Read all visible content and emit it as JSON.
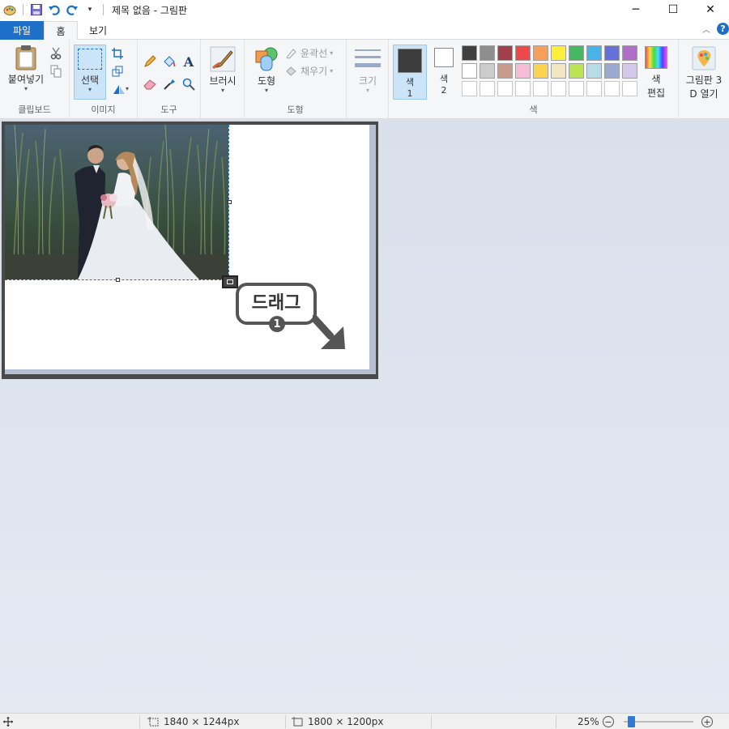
{
  "window": {
    "title": "제목 없음 - 그림판",
    "controls": {
      "minimize": "─",
      "maximize": "☐",
      "close": "✕"
    }
  },
  "tabs": [
    {
      "label": "파일"
    },
    {
      "label": "홈"
    },
    {
      "label": "보기"
    }
  ],
  "ribbon": {
    "clipboard": {
      "paste_label": "붙여넣기",
      "group_label": "클립보드"
    },
    "image": {
      "select_label": "선택",
      "group_label": "이미지"
    },
    "tools": {
      "group_label": "도구"
    },
    "brushes": {
      "label": "브러시"
    },
    "shapes": {
      "shapes_label": "도형",
      "outline_label": "윤곽선",
      "fill_label": "채우기",
      "group_label": "도형"
    },
    "size": {
      "label": "크기"
    },
    "colors": {
      "color1_label": "색",
      "color1_num": "1",
      "color2_label": "색",
      "color2_num": "2",
      "edit_line1": "색",
      "edit_line2": "편집",
      "group_label": "색",
      "color1_value": "#3d3d3d",
      "color2_value": "#ffffff",
      "palette_row1": [
        "#404040",
        "#8e8e8e",
        "#a23f4b",
        "#ec4a4a",
        "#f79f5a",
        "#fdee3c",
        "#46b862",
        "#47b3e8",
        "#6471d9",
        "#b06ec9"
      ],
      "palette_row2": [
        "#ffffff",
        "#cccccc",
        "#c99b8a",
        "#f9bcd6",
        "#fbd34e",
        "#f1e7c2",
        "#b9e351",
        "#b6dcec",
        "#99a9cf",
        "#d5c7ec"
      ]
    },
    "paint3d": {
      "line1": "그림판 3",
      "line2": "D 열기"
    }
  },
  "canvas": {
    "annotation_label": "드래그",
    "annotation_step": "1"
  },
  "status": {
    "selection_size": "1840 × 1244px",
    "canvas_size": "1800 × 1200px",
    "zoom": "25%",
    "zoom_level": 0.25
  }
}
